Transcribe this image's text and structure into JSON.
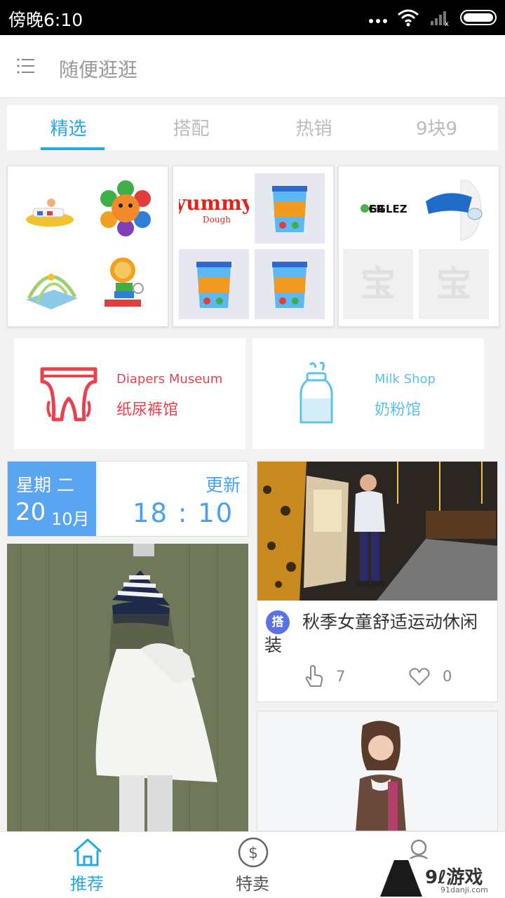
{
  "status_bar": {
    "time": "傍晚6:10"
  },
  "header": {
    "menu_icon": "list-menu-icon",
    "title": "随便逛逛"
  },
  "tabs": [
    {
      "label": "精选",
      "active": true
    },
    {
      "label": "搭配",
      "active": false
    },
    {
      "label": "热销",
      "active": false
    },
    {
      "label": "9块9",
      "active": false
    }
  ],
  "product_cards": [
    {
      "brand": ""
    },
    {
      "brand": "Yummy Dough"
    },
    {
      "brand": "FROGGLEZ",
      "placeholders": [
        "宝",
        "宝"
      ]
    }
  ],
  "shops": [
    {
      "en": "Diapers Museum",
      "cn": "纸尿裤馆",
      "icon": "diaper-icon",
      "color": "#e8414f"
    },
    {
      "en": "Milk Shop",
      "cn": "奶粉馆",
      "icon": "milk-bottle-icon",
      "color": "#5cc0ee"
    }
  ],
  "date_widget": {
    "weekday": "星期 二",
    "day": "20",
    "month": "10月",
    "update_label": "更新",
    "time": "18 : 10"
  },
  "feed": [
    {
      "tag": "搭",
      "caption": "秋季女童舒适运动休闲装",
      "views": "7",
      "likes": "0"
    }
  ],
  "bottom_nav": [
    {
      "label": "推荐",
      "icon": "home-icon",
      "active": true
    },
    {
      "label": "特卖",
      "icon": "dollar-icon",
      "active": false
    },
    {
      "label": "",
      "icon": "user-icon",
      "active": false
    }
  ],
  "watermark": {
    "logo": "9ℓ游戏",
    "site": "91danji.com"
  },
  "colors": {
    "accent": "#25a9e6",
    "date_blue": "#5aa5f2",
    "diaper_red": "#e8414f",
    "milk_blue": "#5cc0ee",
    "tag_purple": "#5b72e6"
  }
}
